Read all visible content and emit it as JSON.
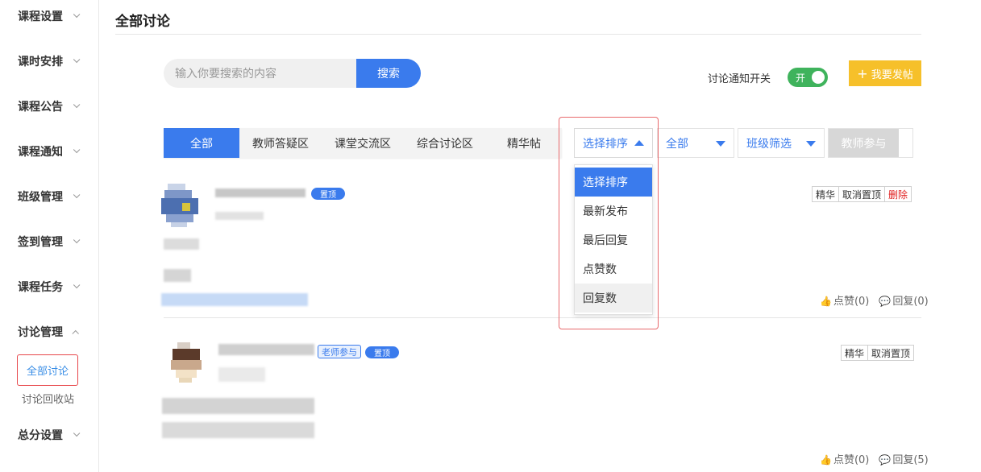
{
  "sidebar": {
    "items": [
      {
        "label": "课程设置"
      },
      {
        "label": "课时安排"
      },
      {
        "label": "课程公告"
      },
      {
        "label": "课程通知"
      },
      {
        "label": "班级管理"
      },
      {
        "label": "签到管理"
      },
      {
        "label": "课程任务"
      },
      {
        "label": "讨论管理"
      },
      {
        "label": "总分设置"
      }
    ],
    "sub": {
      "active": "全部讨论",
      "recycle": "讨论回收站"
    }
  },
  "header": {
    "title": "全部讨论"
  },
  "search": {
    "placeholder": "输入你要搜索的内容",
    "button": "搜索"
  },
  "notify": {
    "label": "讨论通知开关",
    "toggle": "开"
  },
  "post_button": "我要发帖",
  "tabs": [
    {
      "label": "全部"
    },
    {
      "label": "教师答疑区"
    },
    {
      "label": "课堂交流区"
    },
    {
      "label": "综合讨论区"
    },
    {
      "label": "精华帖"
    }
  ],
  "filters": {
    "sort": "选择排序",
    "scope": "全部",
    "class": "班级筛选",
    "teacher": "教师参与"
  },
  "sort_options": [
    {
      "label": "选择排序"
    },
    {
      "label": "最新发布"
    },
    {
      "label": "最后回复"
    },
    {
      "label": "点赞数"
    },
    {
      "label": "回复数"
    }
  ],
  "posts": [
    {
      "badges": {
        "top": "置顶"
      },
      "actions": [
        "精华",
        "取消置顶",
        "删除"
      ],
      "likes": "点赞(0)",
      "replies": "回复(0)"
    },
    {
      "badges": {
        "teacher": "老师参与",
        "top": "置顶"
      },
      "actions": [
        "精华",
        "取消置顶"
      ],
      "likes": "点赞(0)",
      "replies": "回复(5)"
    }
  ],
  "colors": {
    "accent": "#3a7bed",
    "toggle": "#3fb35c",
    "post_button": "#f6c02a",
    "delete": "#e02020",
    "highlight": "#e86a6d"
  }
}
